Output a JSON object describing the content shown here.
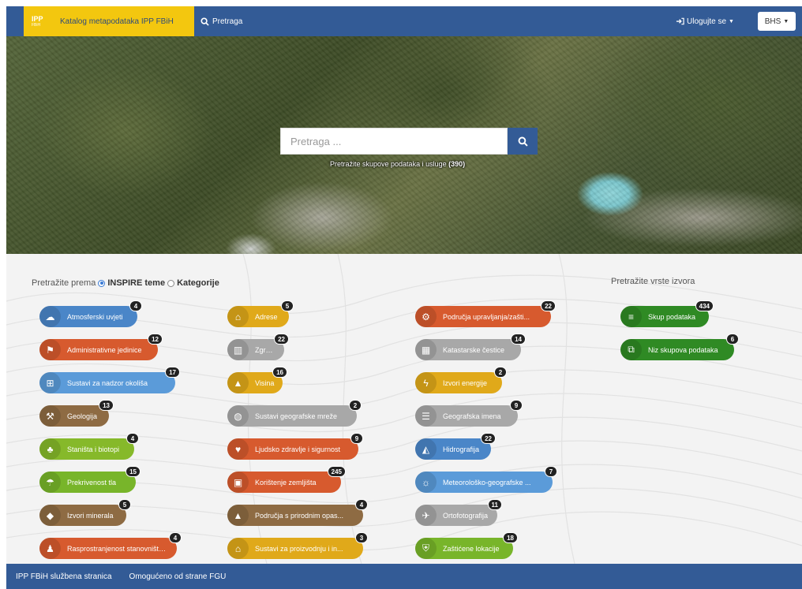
{
  "navbar": {
    "logo_line1": "IPP",
    "logo_line2": "FBiH",
    "title": "Katalog metapodataka IPP FBiH",
    "search_label": "Pretraga",
    "login_label": "Ulogujte se",
    "language": "BHS"
  },
  "hero": {
    "search_placeholder": "Pretraga ...",
    "note_prefix": "Pretražite skupove podataka i usluge",
    "note_count": "(390)"
  },
  "browse": {
    "label": "Pretražite prema",
    "option_inspire": "INSPIRE teme",
    "option_categories": "Kategorije",
    "source_label": "Pretražite vrste izvora"
  },
  "themes": [
    {
      "label": "Atmosferski uvjeti",
      "count": "4",
      "color": "#4a86c8",
      "icon": "cloud-icon"
    },
    {
      "label": "Administrativne jedinice",
      "count": "12",
      "color": "#d75a2e",
      "icon": "map-icon"
    },
    {
      "label": "Sustavi za nadzor okoliša",
      "count": "17",
      "color": "#5b9bd9",
      "icon": "sensor-icon"
    },
    {
      "label": "Geologija",
      "count": "13",
      "color": "#8e6b43",
      "icon": "pickaxe-icon"
    },
    {
      "label": "Staništa i biotopi",
      "count": "4",
      "color": "#86b92a",
      "icon": "habitat-icon"
    },
    {
      "label": "Prekrivenost tla",
      "count": "15",
      "color": "#78b52a",
      "icon": "landcover-icon"
    },
    {
      "label": "Izvori minerala",
      "count": "5",
      "color": "#8e6b43",
      "icon": "diamond-icon"
    },
    {
      "label": "Rasprostranjenost stanovništva ...",
      "count": "4",
      "color": "#d75a2e",
      "icon": "people-icon"
    },
    {
      "label": "Adrese",
      "count": "5",
      "color": "#e0a91a",
      "icon": "address-icon"
    },
    {
      "label": "Zgrade",
      "count": "22",
      "color": "#a8a8a8",
      "icon": "building-icon"
    },
    {
      "label": "Visina",
      "count": "16",
      "color": "#e0a91a",
      "icon": "mountain-icon"
    },
    {
      "label": "Sustavi geografske mreže",
      "count": "2",
      "color": "#a8a8a8",
      "icon": "globe-icon"
    },
    {
      "label": "Ljudsko zdravlje i sigurnost",
      "count": "9",
      "color": "#d75a2e",
      "icon": "heart-icon"
    },
    {
      "label": "Korištenje zemljišta",
      "count": "245",
      "color": "#d75a2e",
      "icon": "landuse-icon"
    },
    {
      "label": "Područja s prirodnim opas...",
      "count": "4",
      "color": "#8e6b43",
      "icon": "hazard-icon"
    },
    {
      "label": "Sustavi za proizvodnju i in...",
      "count": "3",
      "color": "#e0a91a",
      "icon": "factory-icon"
    },
    {
      "label": "Područja upravljanja/zašti...",
      "count": "22",
      "color": "#d75a2e",
      "icon": "management-icon"
    },
    {
      "label": "Katastarske čestice",
      "count": "14",
      "color": "#a8a8a8",
      "icon": "parcel-icon"
    },
    {
      "label": "Izvori energije",
      "count": "2",
      "color": "#e0a91a",
      "icon": "energy-icon"
    },
    {
      "label": "Geografska imena",
      "count": "9",
      "color": "#a8a8a8",
      "icon": "names-icon"
    },
    {
      "label": "Hidrografija",
      "count": "22",
      "color": "#4a86c8",
      "icon": "water-icon"
    },
    {
      "label": "Meteorološko-geografske ...",
      "count": "7",
      "color": "#5b9bd9",
      "icon": "weather-icon"
    },
    {
      "label": "Ortofotografija",
      "count": "11",
      "color": "#a8a8a8",
      "icon": "satellite-icon"
    },
    {
      "label": "Zaštićene lokacije",
      "count": "18",
      "color": "#78b52a",
      "icon": "protected-icon"
    }
  ],
  "sources": [
    {
      "label": "Skup podataka",
      "count": "434",
      "color": "#2f8a24",
      "icon": "database-icon"
    },
    {
      "label": "Niz skupova podataka",
      "count": "6",
      "color": "#2f8a24",
      "icon": "series-icon"
    }
  ],
  "footer": {
    "link1": "IPP FBiH službena stranica",
    "link2": "Omogućeno od strane FGU"
  }
}
